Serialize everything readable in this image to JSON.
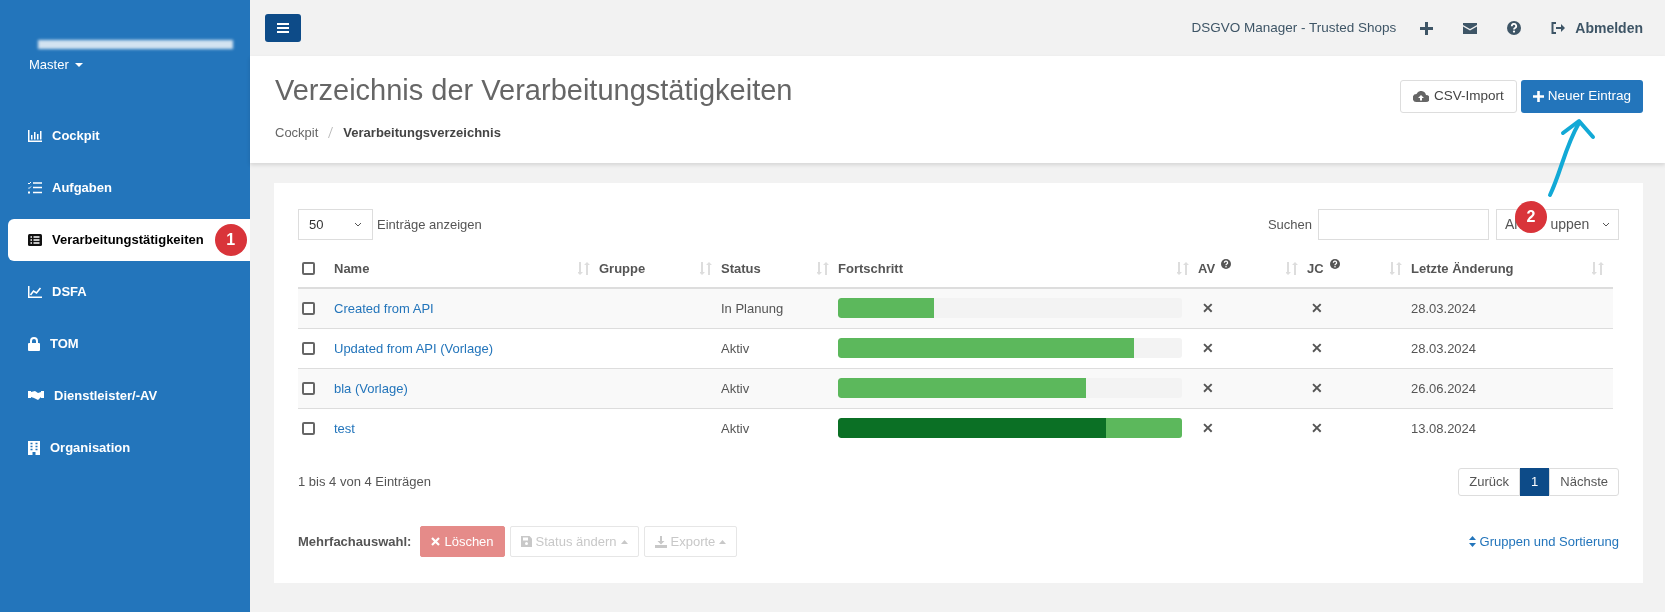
{
  "sidebar": {
    "account_menu": "Master",
    "items": [
      {
        "label": "Cockpit",
        "selected": false
      },
      {
        "label": "Aufgaben",
        "selected": false
      },
      {
        "label": "Verarbeitungstätigkeiten",
        "selected": true,
        "badge": "1"
      },
      {
        "label": "DSFA",
        "selected": false
      },
      {
        "label": "TOM",
        "selected": false
      },
      {
        "label": "Dienstleister/-AV",
        "selected": false
      },
      {
        "label": "Organisation",
        "selected": false
      }
    ]
  },
  "topbar": {
    "app_name": "DSGVO Manager - Trusted Shops",
    "logout": "Abmelden"
  },
  "header": {
    "title": "Verzeichnis der Verarbeitungstätigkeiten",
    "breadcrumbs": [
      "Cockpit",
      "Verarbeitungsverzeichnis"
    ],
    "buttons": [
      {
        "label": "CSV-Import",
        "kind": "default"
      },
      {
        "label": "Neuer Eintrag",
        "kind": "primary"
      }
    ]
  },
  "annotation": {
    "badge": "2"
  },
  "table_controls": {
    "page_length": "50",
    "page_length_label": "Einträge anzeigen",
    "search_label": "Suchen",
    "group_filter": {
      "text_start": "Al",
      "text_end": "uppen"
    }
  },
  "table": {
    "select_all": {
      "checked": false
    },
    "columns": [
      {
        "label": "Name"
      },
      {
        "label": "Gruppe"
      },
      {
        "label": "Status"
      },
      {
        "label": "Fortschritt"
      },
      {
        "label": "AV",
        "help": true
      },
      {
        "label": "JC",
        "help": true
      },
      {
        "label": "Letzte Änderung"
      }
    ],
    "rows": [
      {
        "checked": false,
        "name": "Created from API",
        "status": "In Planung",
        "progress": [
          {
            "level": 0.28,
            "color": "#5cb85c"
          }
        ],
        "av": "✕",
        "jc": "✕",
        "changed": "28.03.2024"
      },
      {
        "checked": false,
        "name": "Updated from API (Vorlage)",
        "status": "Aktiv",
        "progress": [
          {
            "level": 0.86,
            "color": "#5cb85c"
          }
        ],
        "av": "✕",
        "jc": "✕",
        "changed": "28.03.2024"
      },
      {
        "checked": false,
        "name": "bla (Vorlage)",
        "status": "Aktiv",
        "progress": [
          {
            "level": 0.72,
            "color": "#5cb85c"
          }
        ],
        "av": "✕",
        "jc": "✕",
        "changed": "26.06.2024"
      },
      {
        "checked": false,
        "name": "test",
        "status": "Aktiv",
        "progress": [
          {
            "level": 0.78,
            "color": "#0b7025"
          },
          {
            "level": 0.22,
            "color": "#5cb85c"
          }
        ],
        "av": "✕",
        "jc": "✕",
        "changed": "13.08.2024"
      }
    ]
  },
  "info": "1 bis 4 von 4 Einträgen",
  "pagination": [
    {
      "label": "Zurück",
      "selected": false
    },
    {
      "label": "1",
      "selected": true
    },
    {
      "label": "Nächste",
      "selected": false
    }
  ],
  "bulk": {
    "label": "Mehrfachauswahl:",
    "buttons": [
      {
        "label": "Löschen",
        "disabled": false
      },
      {
        "label": "Status ändern",
        "disabled": true
      },
      {
        "label": "Exporte",
        "disabled": true
      }
    ]
  },
  "groups_link": "Gruppen und Sortierung"
}
